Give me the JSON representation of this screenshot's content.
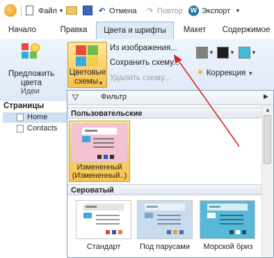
{
  "qat": {
    "file_label": "Файл",
    "undo_label": "Отмена",
    "redo_label": "Повтор",
    "export_label": "Экспорт"
  },
  "tabs": [
    "Начало",
    "Правка",
    "Цвета и шрифты",
    "Макет",
    "Содержимое"
  ],
  "ribbon": {
    "suggest_label_1": "Предложить",
    "suggest_label_2": "цвета",
    "group_ideas": "Идеи",
    "schemes_label_1": "Цветовые",
    "schemes_label_2": "схемы",
    "from_image": "Из изображения...",
    "save_scheme": "Сохранить схему...",
    "delete_scheme": "Удалить схему...",
    "correction": "Коррекция",
    "swatches": [
      "#808080",
      "#1e1e1e",
      "#3fbfdc"
    ]
  },
  "sidebar": {
    "title": "Страницы",
    "pages": [
      "Home",
      "Contacts"
    ]
  },
  "gallery": {
    "filter_label": "Фильтр",
    "custom_header": "Пользовательские",
    "custom_item_1": "Измененный",
    "custom_item_2": "(Измененный..)",
    "gray_header": "Сероватый",
    "themes": [
      {
        "name": "Стандарт",
        "bg": "#ffffff",
        "bar": "#e4e4e4"
      },
      {
        "name": "Под парусами",
        "bg": "#c9dcef",
        "bar": "#e9f0f7"
      },
      {
        "name": "Морской бриз",
        "bg": "#58b8d8",
        "bar": "#d8eef6"
      }
    ]
  },
  "colors": {
    "accent_orange": "#f5c04a",
    "selected_pink": "#f6c2d2",
    "arrow_red": "#d32626"
  }
}
